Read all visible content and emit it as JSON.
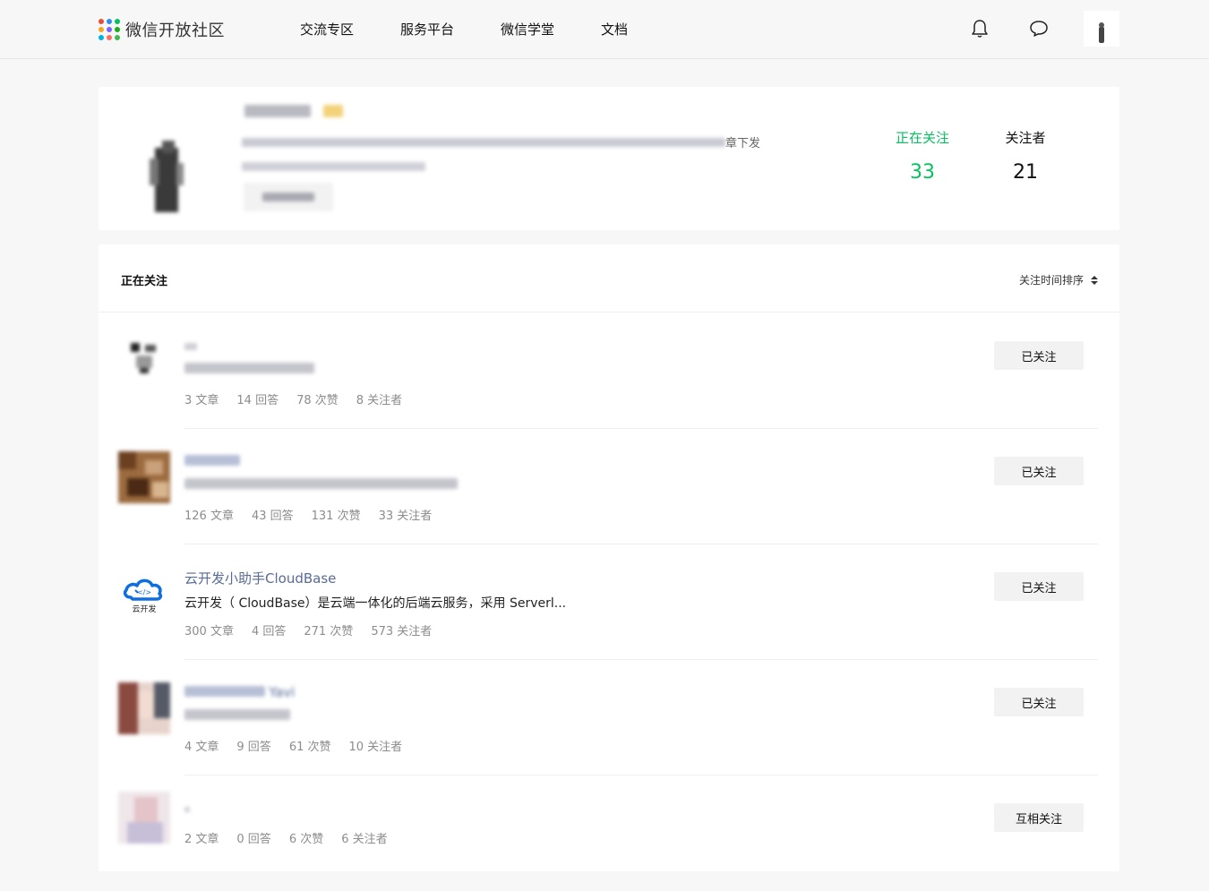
{
  "header": {
    "logo_text": "微信开放社区",
    "nav": [
      "交流专区",
      "服务平台",
      "微信学堂",
      "文档"
    ],
    "bell_icon": "bell-icon",
    "chat_icon": "chat-bubble-icon"
  },
  "profile": {
    "bio_tail": "章下发",
    "stats": {
      "following_label": "正在关注",
      "following_count": "33",
      "followers_label": "关注者",
      "followers_count": "21"
    },
    "accent_color": "#07c160"
  },
  "list": {
    "title": "正在关注",
    "sort_label": "关注时间排序",
    "users": [
      {
        "name": "",
        "bio": "",
        "articles": "3 文章",
        "answers": "14 回答",
        "likes": "78 次赞",
        "followers": "8 关注者",
        "button": "已关注"
      },
      {
        "name": "",
        "bio": "",
        "articles": "126 文章",
        "answers": "43 回答",
        "likes": "131 次赞",
        "followers": "33 关注者",
        "button": "已关注"
      },
      {
        "name": "云开发小助手CloudBase",
        "bio": "云开发（ CloudBase）是云端一体化的后端云服务，采用 Serverl...",
        "avatar_label": "云开发",
        "articles": "300 文章",
        "answers": "4 回答",
        "likes": "271 次赞",
        "followers": "573 关注者",
        "button": "已关注"
      },
      {
        "name": "Yavi",
        "bio": "",
        "articles": "4 文章",
        "answers": "9 回答",
        "likes": "61 次赞",
        "followers": "10 关注者",
        "button": "已关注"
      },
      {
        "name": "",
        "bio": "",
        "articles": "2 文章",
        "answers": "0 回答",
        "likes": "6 次赞",
        "followers": "6 关注者",
        "button": "互相关注"
      }
    ]
  },
  "colors": {
    "link": "#576b95",
    "muted": "#8c8c8c",
    "background": "#f7f7f7"
  }
}
